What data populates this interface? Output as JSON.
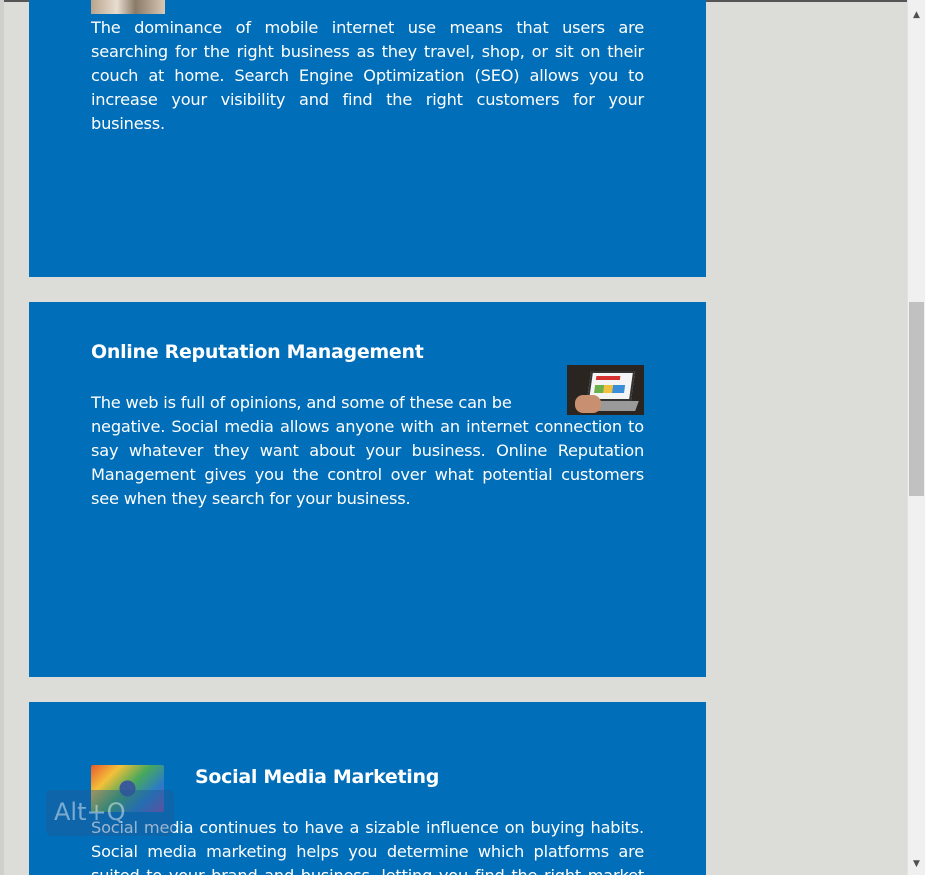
{
  "cards": [
    {
      "title": "",
      "image": "seo-thumbnail",
      "body": "The dominance of mobile internet use means that users are searching for the right business as they travel, shop, or sit on their couch at home. Search Engine Optimization (SEO) allows you to increase your visibility and find the right customers for your business."
    },
    {
      "title": "Online Reputation Management",
      "image": "laptop-reviews-thumbnail",
      "body_first_line": "The web is full of opinions, and some of these can be",
      "body_rest": "negative. Social media allows anyone with an internet connection to say whatever they want about your business. Online Reputation Management gives you the control over what potential customers see when they search for your business."
    },
    {
      "title": "Social Media Marketing",
      "image": "social-media-icons-thumbnail",
      "body": "Social media continues to have a sizable influence on buying habits. Social media marketing helps you determine which platforms are suited to your brand and business, letting you find the right market and"
    }
  ],
  "watermark": "Alt+Q",
  "scrollbar": {
    "up_icon": "▲",
    "down_icon": "▼"
  },
  "colors": {
    "card_background": "#006eb8",
    "page_background": "#dcdcd8",
    "text": "#ffffff"
  }
}
